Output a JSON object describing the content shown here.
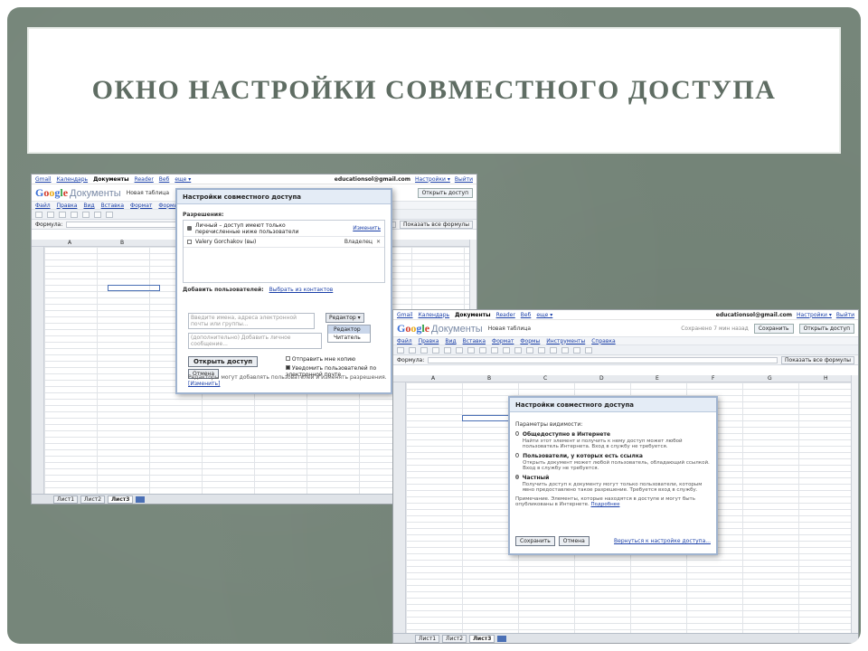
{
  "slide": {
    "title": "ОКНО НАСТРОЙКИ СОВМЕСТНОГО ДОСТУПА"
  },
  "screen1": {
    "topbar": {
      "links": [
        "Gmail",
        "Календарь",
        "Документы",
        "Reader",
        "Веб",
        "еще ▾"
      ],
      "account": "educationsol@gmail.com",
      "settings": "Настройки ▾",
      "help": "Выйти"
    },
    "header": {
      "logo_google": "Google",
      "logo_docs": "Документы",
      "doc_name": "Новая таблица",
      "share_button": "Открыть доступ"
    },
    "menu": [
      "Файл",
      "Правка",
      "Вид",
      "Вставка",
      "Формат",
      "Формы"
    ],
    "formula_label": "Формула:",
    "show_all_formulas": "Показать все формулы",
    "columns": [
      "A",
      "B"
    ],
    "sheet_tabs": [
      "Лист1",
      "Лист2",
      "Лист3"
    ]
  },
  "dialog1": {
    "title": "Настройки совместного доступа",
    "permissions_label": "Разрешения:",
    "private_text": "Личный – доступ имеют только перечисленные ниже пользователи",
    "change_link": "Изменить",
    "user_name": "Valery Gorchakov (вы)",
    "user_role": "Владелец",
    "add_people_label": "Добавить пользователей:",
    "select_contacts": "Выбрать из контактов",
    "names_placeholder": "Введите имена, адреса электронной почты или группы...",
    "message_placeholder": "(дополнительно) Добавить личное сообщение...",
    "role_button": "Редактор ▾",
    "role_options": [
      "Редактор",
      "Читатель"
    ],
    "share_button": "Открыть доступ",
    "cancel_button": "Отмена",
    "send_copy": "Отправить мне копию",
    "notify": "Уведомить пользователей по электронной почте",
    "editors_note": "Редакторы могут добавлять пользователей и изменять разрешения.",
    "editors_link": "[Изменить]"
  },
  "screen2": {
    "topbar": {
      "links": [
        "Gmail",
        "Календарь",
        "Документы",
        "Reader",
        "Веб",
        "еще ▾"
      ],
      "account": "educationsol@gmail.com",
      "settings": "Настройки ▾",
      "help": "Выйти"
    },
    "header": {
      "logo_google": "Google",
      "logo_docs": "Документы",
      "doc_name": "Новая таблица",
      "saved_text": "Сохранено 7 мин назад",
      "save_button": "Сохранить",
      "share_button": "Открыть доступ"
    },
    "menu": [
      "Файл",
      "Правка",
      "Вид",
      "Вставка",
      "Формат",
      "Формы",
      "Инструменты",
      "Справка"
    ],
    "formula_label": "Формула:",
    "show_all_formulas": "Показать все формулы",
    "columns": [
      "A",
      "B",
      "C",
      "D",
      "E",
      "F",
      "G",
      "H"
    ],
    "sheet_tabs": [
      "Лист1",
      "Лист2",
      "Лист3"
    ]
  },
  "dialog2": {
    "title": "Настройки совместного доступа",
    "visibility_label": "Параметры видимости:",
    "options": [
      {
        "title": "Общедоступно в Интернете",
        "desc": "Найти этот элемент и получить к нему доступ может любой пользователь Интернета. Вход в службу не требуется."
      },
      {
        "title": "Пользователи, у которых есть ссылка",
        "desc": "Открыть документ может любой пользователь, обладающий ссылкой. Вход в службу не требуется."
      },
      {
        "title": "Частный",
        "desc": "Получить доступ к документу могут только пользователи, которым явно предоставлено такое разрешение. Требуется вход в службу."
      }
    ],
    "note": "Примечание. Элементы, которые находятся в доступе и могут быть опубликованы в Интернете.",
    "more_link": "Подробнее",
    "save_button": "Сохранить",
    "cancel_button": "Отмена",
    "back_link": "Вернуться к настройке доступа..."
  }
}
